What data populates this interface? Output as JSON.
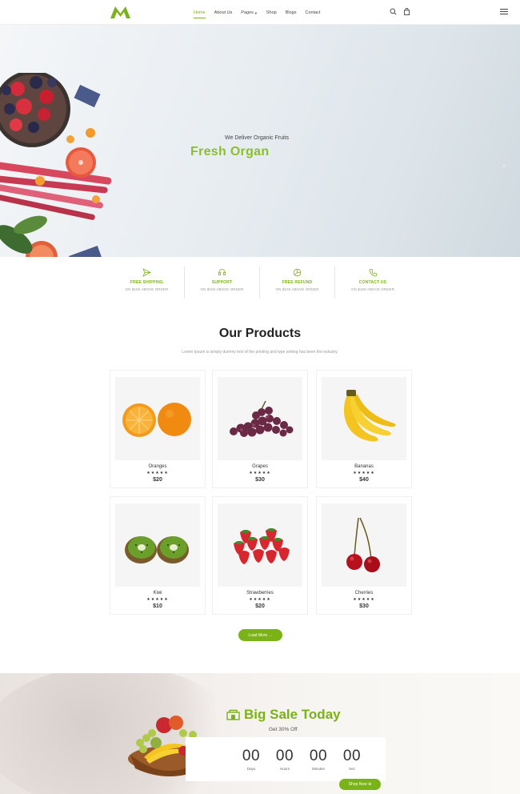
{
  "header": {
    "nav": [
      {
        "label": "Home",
        "active": true
      },
      {
        "label": "About Us",
        "active": false
      },
      {
        "label": "Pages",
        "active": false,
        "dropdown": true
      },
      {
        "label": "Shop",
        "active": false
      },
      {
        "label": "Blogs",
        "active": false
      },
      {
        "label": "Contact",
        "active": false
      }
    ],
    "icons": [
      "search-icon",
      "bag-icon",
      "menu-icon"
    ]
  },
  "hero": {
    "subtitle": "We Deliver Organic Fruits",
    "title": "Fresh Organ"
  },
  "features": [
    {
      "icon": "paper-plane-icon",
      "title": "FREE SHIPPING",
      "desc": "ON $100 ABOVE ORDER"
    },
    {
      "icon": "headset-icon",
      "title": "SUPPORT",
      "desc": "ON $100 ABOVE ORDER"
    },
    {
      "icon": "refund-icon",
      "title": "FREE REFUND",
      "desc": "ON $100 ABOVE ORDER"
    },
    {
      "icon": "phone-icon",
      "title": "CONTACT US",
      "desc": "ON $100 ABOVE ORDER"
    }
  ],
  "products_section": {
    "title": "Our Products",
    "desc": "Lorem Ipsum is simply dummy text of the printing and type setting has been the industry.",
    "items": [
      {
        "name": "Oranges",
        "stars": "★★★★★",
        "price": "$20"
      },
      {
        "name": "Grapes",
        "stars": "★★★★★",
        "price": "$30"
      },
      {
        "name": "Bananas",
        "stars": "★★★★★",
        "price": "$40"
      },
      {
        "name": "Kiwi",
        "stars": "★★★★★",
        "price": "$10"
      },
      {
        "name": "Strawberries",
        "stars": "★★★★★",
        "price": "$20"
      },
      {
        "name": "Cherries",
        "stars": "★★★★★",
        "price": "$30"
      }
    ],
    "load_more": "Load More →"
  },
  "sale": {
    "title": "Big Sale Today",
    "subtitle": "Get 30% Off",
    "countdown": [
      {
        "value": "00",
        "label": "Days"
      },
      {
        "value": "00",
        "label": "Hours"
      },
      {
        "value": "00",
        "label": "Minutes"
      },
      {
        "value": "00",
        "label": "Sec"
      }
    ],
    "shop_now": "Shop Now ⊕"
  },
  "colors": {
    "accent": "#7ab317",
    "text": "#333333"
  }
}
